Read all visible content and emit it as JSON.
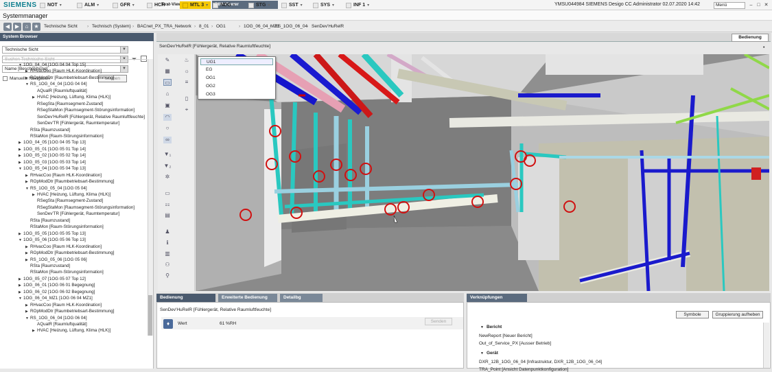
{
  "topbar": {
    "brand": "SIEMENS",
    "alarms": [
      {
        "label": "NOT",
        "active": false
      },
      {
        "label": "ALM",
        "active": false
      },
      {
        "label": "GFR",
        "active": false
      },
      {
        "label": "HCH",
        "active": false
      },
      {
        "label": "MTL 3",
        "active": true
      },
      {
        "label": "NDG",
        "active": false
      },
      {
        "label": "STG",
        "active": false
      },
      {
        "label": "SST",
        "active": false
      },
      {
        "label": "SYS",
        "active": false
      },
      {
        "label": "INF 1",
        "active": false
      }
    ],
    "caret": "▾",
    "user_info": "YMSU044984  SIEMENS Desigo CC Administrator  02.07.2020 14:42",
    "menu": "Menü",
    "accent_color": "#f5c800",
    "brand_color": "#0f7f8f"
  },
  "app_title": "Systemmanager",
  "breadcrumb": [
    "Technische Sicht",
    "Technisch (System)",
    "BACnet_PX_TRA_Network",
    "8_01",
    "OG1",
    "1OG_06_04_MZ1",
    "RS_1OG_06_04",
    "SenDev'HuRelR"
  ],
  "left_panel": {
    "header": "System Browser",
    "view_select": "Technische Sicht",
    "search_placeholder": "Suchen Technische Sicht",
    "name_select": "Name [Beschreibung]",
    "manual_nav": "Manuelle Navigation",
    "search_button": "Suchen",
    "tree": [
      {
        "d": 0,
        "e": "down",
        "t": "1OG_04_04 [1OG 04 04 Top 15]"
      },
      {
        "d": 1,
        "e": "right",
        "t": "RHvacCoo [Raum HLK-Koordination]"
      },
      {
        "d": 1,
        "e": "right",
        "t": "ROpModDtr [Raumbetriebsart-Bestimmung]"
      },
      {
        "d": 1,
        "e": "down",
        "t": "RS_1OG_04_04 [1OG 04 04]"
      },
      {
        "d": 2,
        "e": "",
        "t": "AQualR [Raumluftqualität]"
      },
      {
        "d": 2,
        "e": "right",
        "t": "HVAC [Heizung, Lüftung, Klima (HLK)]"
      },
      {
        "d": 2,
        "e": "",
        "t": "RSegSta [Raumsegment-Zustand]"
      },
      {
        "d": 2,
        "e": "",
        "t": "RSegStaMon [Raumsegment-Störungsinformation]"
      },
      {
        "d": 2,
        "e": "",
        "t": "SenDev'HuRelR [Fühlergerät, Relative Raumluftfeuchte]"
      },
      {
        "d": 2,
        "e": "",
        "t": "SenDev'TR [Fühlergerät, Raumtemperatur]"
      },
      {
        "d": 1,
        "e": "",
        "t": "RSta [Raumzustand]"
      },
      {
        "d": 1,
        "e": "",
        "t": "RStaMon [Raum-Störungsinformation]"
      },
      {
        "d": 0,
        "e": "right",
        "t": "1OG_04_05 [1OG 04 05 Top 13]"
      },
      {
        "d": 0,
        "e": "right",
        "t": "1OG_05_01 [1OG 05 01 Top 14]"
      },
      {
        "d": 0,
        "e": "right",
        "t": "1OG_05_02 [1OG 05 02 Top 14]"
      },
      {
        "d": 0,
        "e": "right",
        "t": "1OG_05_03 [1OG 05 03 Top 14]"
      },
      {
        "d": 0,
        "e": "down",
        "t": "1OG_05_04 [1OG 05 04 Top 13]"
      },
      {
        "d": 1,
        "e": "right",
        "t": "RHvacCoo [Raum HLK-Koordination]"
      },
      {
        "d": 1,
        "e": "right",
        "t": "ROpModDtr [Raumbetriebsart-Bestimmung]"
      },
      {
        "d": 1,
        "e": "down",
        "t": "RS_1OG_05_04 [1OG 05 04]"
      },
      {
        "d": 2,
        "e": "right",
        "t": "HVAC [Heizung, Lüftung, Klima (HLK)]"
      },
      {
        "d": 2,
        "e": "",
        "t": "RSegSta [Raumsegment-Zustand]"
      },
      {
        "d": 2,
        "e": "",
        "t": "RSegStaMon [Raumsegment-Störungsinformation]"
      },
      {
        "d": 2,
        "e": "",
        "t": "SenDev'TR [Fühlergerät, Raumtemperatur]"
      },
      {
        "d": 1,
        "e": "",
        "t": "RSta [Raumzustand]"
      },
      {
        "d": 1,
        "e": "",
        "t": "RStaMon [Raum-Störungsinformation]"
      },
      {
        "d": 0,
        "e": "right",
        "t": "1OG_05_05 [1OG 05 05 Top 13]"
      },
      {
        "d": 0,
        "e": "down",
        "t": "1OG_05_06 [1OG 05 06 Top 13]"
      },
      {
        "d": 1,
        "e": "right",
        "t": "RHvacCoo [Raum HLK-Koordination]"
      },
      {
        "d": 1,
        "e": "right",
        "t": "ROpModDtr [Raumbetriebsart-Bestimmung]"
      },
      {
        "d": 1,
        "e": "right",
        "t": "RS_1OG_05_06 [1OG 05 06]"
      },
      {
        "d": 1,
        "e": "",
        "t": "RSta [Raumzustand]"
      },
      {
        "d": 1,
        "e": "",
        "t": "RStaMon [Raum-Störungsinformation]"
      },
      {
        "d": 0,
        "e": "right",
        "t": "1OG_05_07 [1OG 05 07 Top 12]"
      },
      {
        "d": 0,
        "e": "right",
        "t": "1OG_06_01 [1OG 06 01 Begegnung]"
      },
      {
        "d": 0,
        "e": "right",
        "t": "1OG_06_02 [1OG 06 02 Begegnung]"
      },
      {
        "d": 0,
        "e": "down",
        "t": "1OG_06_04_MZ1 [1OG 06 04 MZ1]"
      },
      {
        "d": 1,
        "e": "right",
        "t": "RHvacCoo [Raum HLK-Koordination]"
      },
      {
        "d": 1,
        "e": "right",
        "t": "ROpModDtr [Raumbetriebsart-Bestimmung]"
      },
      {
        "d": 1,
        "e": "down",
        "t": "RS_1OG_06_04 [1OG 06 04]"
      },
      {
        "d": 2,
        "e": "",
        "t": "AQualR [Raumluftqualität]"
      },
      {
        "d": 2,
        "e": "right",
        "t": "HVAC [Heizung, Lüftung, Klima (HLK)]"
      }
    ]
  },
  "tabs": {
    "text_viewer": "Text-Viewer",
    "bim_viewer": "BIM-Viewer",
    "right": "Bedienung"
  },
  "viewer": {
    "path": "SenDev'HuRelR [Fühlergerät, Relative Raumluftfeuchte]",
    "floors": [
      "UG1",
      "EG",
      "OG1",
      "OG2",
      "OG3"
    ],
    "selected_floor": "UG1"
  },
  "bottom": {
    "tabs": [
      "Bedienung",
      "Erweiterte Bedienung",
      "Detailbg"
    ],
    "path": "SenDev'HuRelR [Fühlergerät, Relative Raumluftfeuchte]",
    "value_label": "Wert",
    "value": "61 %RH",
    "send": "Senden"
  },
  "links": {
    "tab": "Verknüpfungen",
    "symbols_btn": "Symbole",
    "ungroup_btn": "Gruppierung aufheben",
    "groups": [
      {
        "name": "Bericht",
        "items": [
          "NewReport [Neuer Bericht]",
          "Out_of_Service_PX [Ausser Betrieb]"
        ]
      },
      {
        "name": "Gerät",
        "items": [
          "DXR_12B_1OG_06_04 [Infrastruktur, DXR_12B_1OG_06_04]",
          "TRA_Point [Ansicht Datenpunktkonfiguration]"
        ]
      }
    ]
  }
}
